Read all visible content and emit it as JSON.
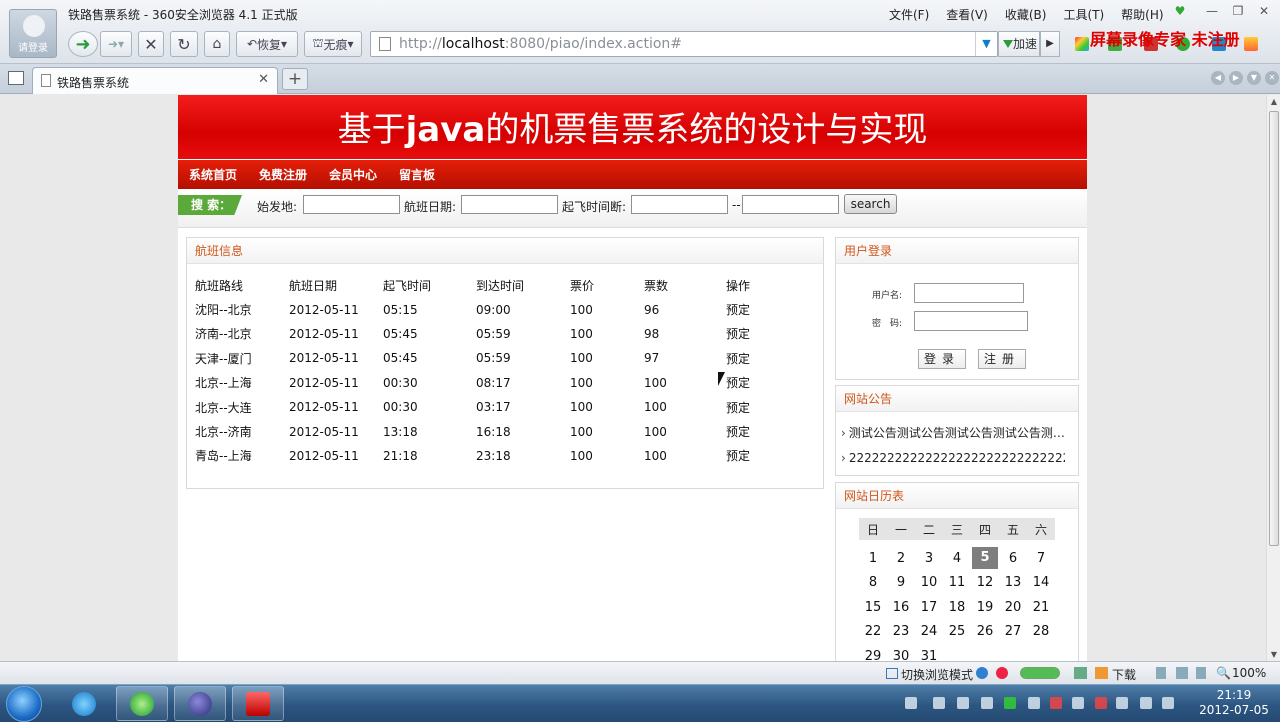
{
  "browser": {
    "window_title": "铁路售票系统 - 360安全浏览器 4.1 正式版",
    "avatar_label": "请登录",
    "menus": [
      "文件(F)",
      "查看(V)",
      "收藏(B)",
      "工具(T)",
      "帮助(H)"
    ],
    "toolbar": {
      "restore_label": "恢复",
      "private_label": "无痕",
      "accelerate_label": "加速"
    },
    "address": {
      "protocol": "http://",
      "host": "localhost",
      "path": ":8080/piao/index.action#"
    },
    "watermark": "屏幕录像专家 未注册",
    "tab_title": "铁路售票系统",
    "status": {
      "mode_label": "切换浏览模式",
      "download_label": "下载",
      "zoom": "100%"
    }
  },
  "site": {
    "banner_prefix": "基于",
    "banner_java": "java",
    "banner_suffix": "的机票售票系统的设计与实现",
    "nav": [
      "系统首页",
      "免费注册",
      "会员中心",
      "留言板"
    ],
    "search": {
      "tag": "搜 索：",
      "origin_label": "始发地:",
      "date_label": "航班日期:",
      "time_label": "起飞时间断:",
      "range_sep": "--",
      "button": "search"
    },
    "flights": {
      "title": "航班信息",
      "headers": [
        "航班路线",
        "航班日期",
        "起飞时间",
        "到达时间",
        "票价",
        "票数",
        "操作"
      ],
      "rows": [
        [
          "沈阳--北京",
          "2012-05-11",
          "05:15",
          "09:00",
          "100",
          "96",
          "预定"
        ],
        [
          "济南--北京",
          "2012-05-11",
          "05:45",
          "05:59",
          "100",
          "98",
          "预定"
        ],
        [
          "天津--厦门",
          "2012-05-11",
          "05:45",
          "05:59",
          "100",
          "97",
          "预定"
        ],
        [
          "北京--上海",
          "2012-05-11",
          "00:30",
          "08:17",
          "100",
          "100",
          "预定"
        ],
        [
          "北京--大连",
          "2012-05-11",
          "00:30",
          "03:17",
          "100",
          "100",
          "预定"
        ],
        [
          "北京--济南",
          "2012-05-11",
          "13:18",
          "16:18",
          "100",
          "100",
          "预定"
        ],
        [
          "青岛--上海",
          "2012-05-11",
          "21:18",
          "23:18",
          "100",
          "100",
          "预定"
        ]
      ]
    },
    "login": {
      "title": "用户登录",
      "username_label": "用户名:",
      "password_label": "密　码:",
      "login_button": "登录",
      "register_button": "注册"
    },
    "notice": {
      "title": "网站公告",
      "items": [
        "测试公告测试公告测试公告测试公告测…",
        "2222222222222222222222222222222..."
      ]
    },
    "calendar": {
      "title": "网站日历表",
      "weekdays": [
        "日",
        "一",
        "二",
        "三",
        "四",
        "五",
        "六"
      ],
      "weeks": [
        [
          "1",
          "2",
          "3",
          "4",
          "5",
          "6",
          "7"
        ],
        [
          "8",
          "9",
          "10",
          "11",
          "12",
          "13",
          "14"
        ],
        [
          "15",
          "16",
          "17",
          "18",
          "19",
          "20",
          "21"
        ],
        [
          "22",
          "23",
          "24",
          "25",
          "26",
          "27",
          "28"
        ],
        [
          "29",
          "30",
          "31",
          "",
          "",
          "",
          ""
        ]
      ],
      "today": "5"
    }
  },
  "taskbar": {
    "time": "21:19",
    "date": "2012-07-05"
  },
  "colors": {
    "banner_red": "#e00000",
    "nav_red": "#c41400",
    "panel_title_orange": "#d0561b",
    "search_tag_green": "#5aa93a"
  }
}
